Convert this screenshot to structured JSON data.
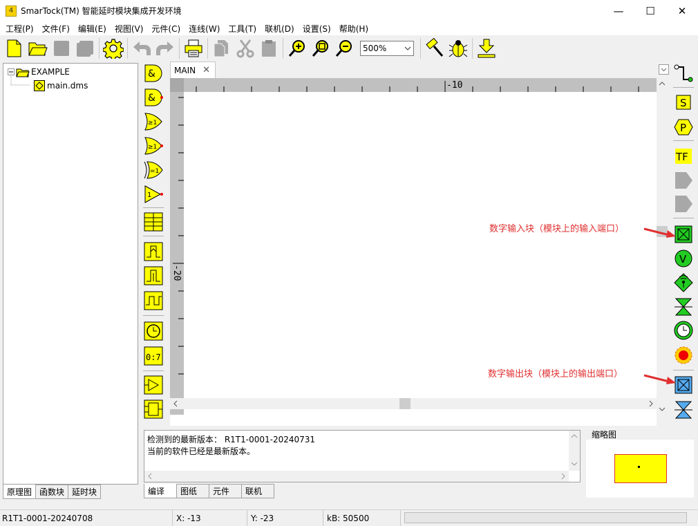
{
  "window": {
    "title": "SmarTock(TM) 智能延时模块集成开发环境",
    "app_icon_text": "4"
  },
  "menu": [
    "工程(P)",
    "文件(F)",
    "编辑(E)",
    "视图(V)",
    "元件(C)",
    "连线(W)",
    "工具(T)",
    "联机(D)",
    "设置(S)",
    "帮助(H)"
  ],
  "toolbar": {
    "zoom_value": "500%"
  },
  "project_tree": {
    "root": "EXAMPLE",
    "file": "main.dms"
  },
  "left_tabs": [
    "原理图",
    "函数块",
    "延时块"
  ],
  "palette_labels": {
    "and": "&",
    "or": "≥1",
    "xor": "=1",
    "not": "1",
    "clock_digits": "0:7"
  },
  "editor": {
    "tab_label": "MAIN",
    "ruler_top_label": "-10",
    "ruler_left_label": "-20"
  },
  "right_palette_labels": {
    "s": "S",
    "p": "P",
    "tf": "TF",
    "v": "V"
  },
  "annotations": {
    "input_block": "数字输入块（模块上的输入端口）",
    "output_block": "数字输出块（模块上的输出端口）"
  },
  "output_panel": {
    "line1": "检测到的最新版本：  R1T1-0001-20240731",
    "line2": "当前的软件已经是最新版本。"
  },
  "output_tabs": [
    "编译",
    "图纸",
    "元件",
    "联机"
  ],
  "thumbnail": {
    "title": "缩略图"
  },
  "statusbar": {
    "version": "R1T1-0001-20240708",
    "x": "X: -13",
    "y": "Y: -23",
    "kb": "kB: 50500"
  },
  "colors": {
    "yellow": "#ffff00",
    "green": "#22cc22",
    "blue": "#55aaee",
    "annotation_red": "#e03030"
  }
}
